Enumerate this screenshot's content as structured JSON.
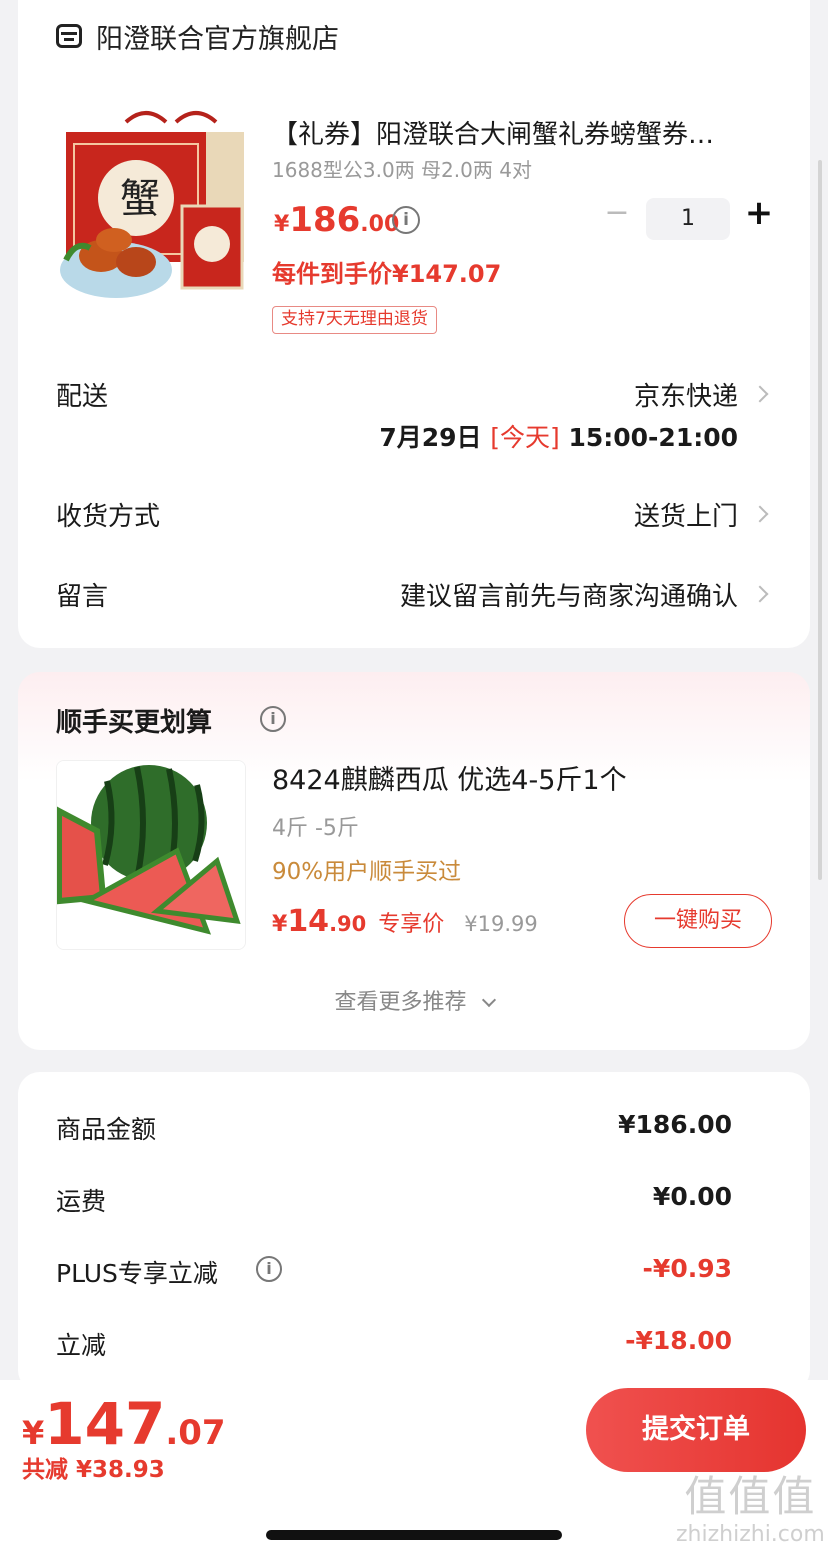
{
  "store": {
    "name": "阳澄联合官方旗舰店",
    "icon": "store-icon"
  },
  "product": {
    "title": "【礼券】阳澄联合大闸蟹礼券螃蟹券…",
    "spec": "1688型公3.0两 母2.0两 4对",
    "currency": "¥",
    "price_int": "186",
    "price_dec": ".00",
    "quantity": "1",
    "qty_minus": "−",
    "qty_plus": "+",
    "unit_price_label": "每件到手价¥147.07",
    "return_tag": "支持7天无理由退货"
  },
  "rows": {
    "delivery_label": "配送",
    "delivery_value": "京东快递",
    "delivery_date": "7月29日",
    "delivery_today": "[今天]",
    "delivery_window": "15:00-21:00",
    "receive_label": "收货方式",
    "receive_value": "送货上门",
    "note_label": "留言",
    "note_placeholder": "建议留言前先与商家沟通确认"
  },
  "recommend": {
    "title": "顺手买更划算",
    "item_name": "8424麒麟西瓜 优选4-5斤1个",
    "item_spec": "4斤 -5斤",
    "item_bought": "90%用户顺手买过",
    "currency": "¥",
    "price_int": "14",
    "price_dec": ".90",
    "exclusive_label": "专享价",
    "original_price": "¥19.99",
    "buy_button": "一键购买",
    "more": "查看更多推荐"
  },
  "summary": {
    "goods_label": "商品金额",
    "goods_value": "¥186.00",
    "shipping_label": "运费",
    "shipping_value": "¥0.00",
    "plus_label": "PLUS专享立减",
    "plus_value": "-¥0.93",
    "instant_label": "立减",
    "instant_value": "-¥18.00"
  },
  "bottom": {
    "currency": "¥",
    "total_int": "147",
    "total_dec": ".07",
    "total_saved": "共减 ¥38.93",
    "submit": "提交订单",
    "watermark_big": "值值值",
    "watermark_url": "zhizhizhi.com"
  },
  "colors": {
    "accent": "#e63a2e",
    "background": "#f2f2f4",
    "bought": "#c98a3a"
  }
}
